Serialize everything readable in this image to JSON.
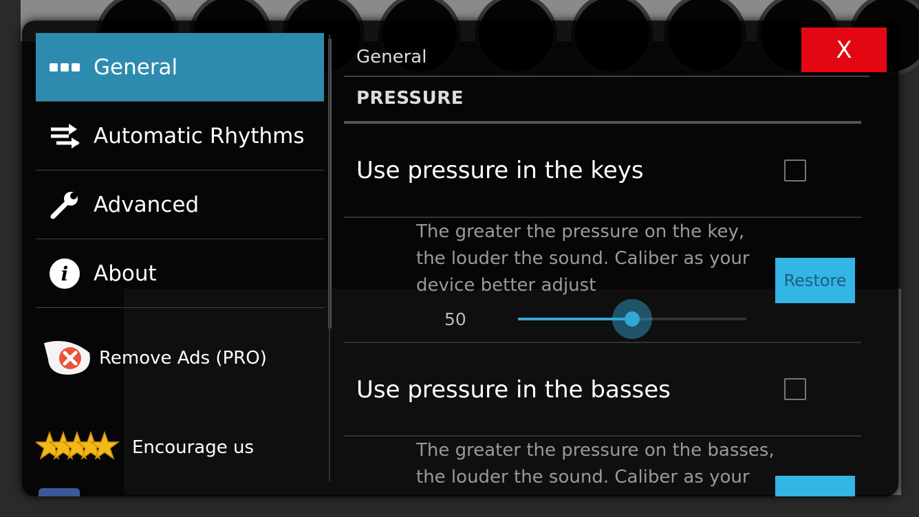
{
  "close_label": "X",
  "menu": {
    "items": [
      {
        "label": "General",
        "icon": "dots-icon",
        "active": true
      },
      {
        "label": "Automatic Rhythms",
        "icon": "shuffle-arrows-icon",
        "active": false
      },
      {
        "label": "Advanced",
        "icon": "wrench-icon",
        "active": false
      },
      {
        "label": "About",
        "icon": "info-icon",
        "active": false
      }
    ],
    "extras": [
      {
        "label": "Remove Ads (PRO)",
        "icon": "remove-ads-icon"
      },
      {
        "label": "Encourage us",
        "icon": "stars-icon"
      }
    ]
  },
  "panel": {
    "title": "General",
    "section": "PRESSURE",
    "prefs": [
      {
        "title": "Use pressure in the keys",
        "checked": false,
        "desc_lines": [
          "The greater the pressure on the key,",
          "the louder the sound. Caliber as your",
          "device better adjust"
        ],
        "restore_label": "Restore",
        "slider_value": "50",
        "slider_fraction": 0.5
      },
      {
        "title": "Use pressure in the basses",
        "checked": false,
        "desc_lines": [
          "The greater the pressure on the basses,",
          "the louder the sound. Caliber as your"
        ]
      }
    ]
  },
  "colors": {
    "accent": "#2e8bb0",
    "close": "#e30613",
    "restore": "#33b5e5"
  }
}
